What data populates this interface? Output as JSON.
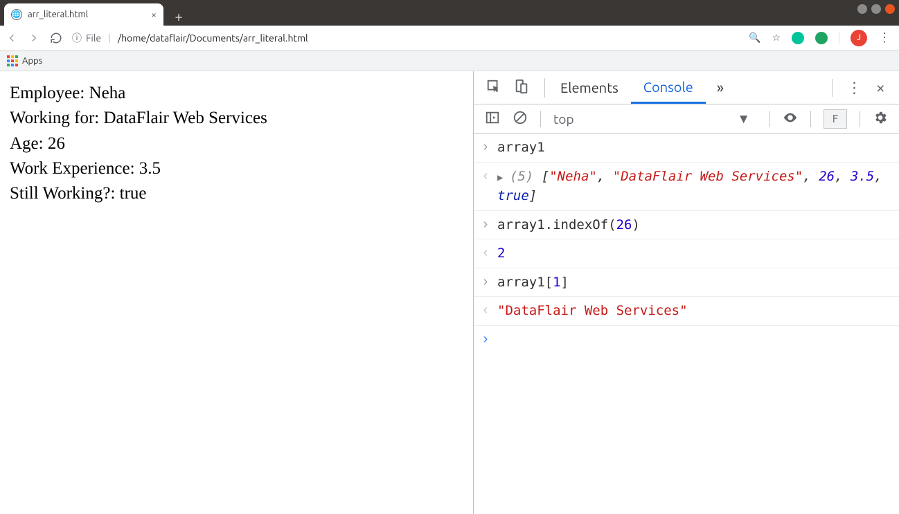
{
  "window": {
    "tab_title": "arr_literal.html",
    "address_label": "File",
    "address_path": "/home/dataflair/Documents/arr_literal.html",
    "apps_label": "Apps",
    "avatar_letter": "J"
  },
  "page": {
    "lines": [
      "Employee: Neha",
      "Working for: DataFlair Web Services",
      "Age: 26",
      "Work Experience: 3.5",
      "Still Working?: true"
    ]
  },
  "devtools": {
    "tabs": {
      "elements": "Elements",
      "console": "Console"
    },
    "context": "top",
    "filter_letter": "F",
    "console_rows": [
      {
        "kind": "input",
        "text": "array1"
      },
      {
        "kind": "output_array",
        "count": "(5)",
        "open": "[",
        "close": "]",
        "items": [
          {
            "type": "str",
            "text": "\"Neha\""
          },
          {
            "type": "str",
            "text": "\"DataFlair Web Services\""
          },
          {
            "type": "num",
            "text": "26"
          },
          {
            "type": "num",
            "text": "3.5"
          },
          {
            "type": "bool",
            "text": "true"
          }
        ]
      },
      {
        "kind": "input",
        "text_parts": [
          {
            "type": "plain",
            "text": "array1.indexOf("
          },
          {
            "type": "num",
            "text": "26"
          },
          {
            "type": "plain",
            "text": ")"
          }
        ]
      },
      {
        "kind": "output_num",
        "text": "2"
      },
      {
        "kind": "input",
        "text_parts": [
          {
            "type": "plain",
            "text": "array1["
          },
          {
            "type": "num",
            "text": "1"
          },
          {
            "type": "plain",
            "text": "]"
          }
        ]
      },
      {
        "kind": "output_str",
        "text": "\"DataFlair Web Services\""
      }
    ]
  }
}
